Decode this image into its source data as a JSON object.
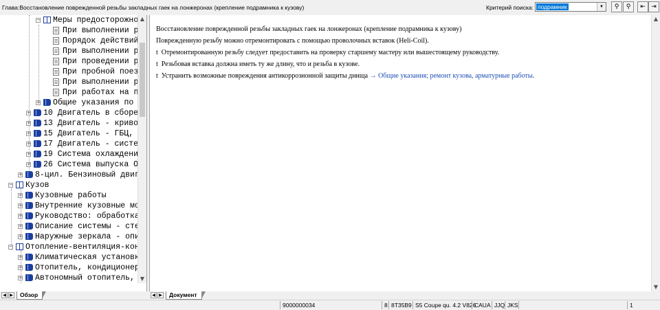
{
  "topbar": {
    "chapter_title": "Глава:Восстановление поврежденной резьбы закладных гаек на лонжеронах (крепление подрамника к кузову)",
    "search_label": "Критерий  поиска:",
    "search_value": "подрамник",
    "buttons": [
      "search-binoculars",
      "search-binoculars-next",
      "navigate-back",
      "navigate-forward"
    ]
  },
  "tree": {
    "items": [
      {
        "label": "Меры предосторожно",
        "icon": "open-book-icon",
        "expander": "minus"
      },
      {
        "label": "При выполнении р",
        "icon": "document-icon",
        "expander": ""
      },
      {
        "label": "Порядок действий",
        "icon": "document-icon",
        "expander": ""
      },
      {
        "label": "При выполнении р",
        "icon": "document-icon",
        "expander": ""
      },
      {
        "label": "При проведении р",
        "icon": "document-icon",
        "expander": ""
      },
      {
        "label": "При пробной поезд",
        "icon": "document-icon",
        "expander": ""
      },
      {
        "label": "При выполнении р",
        "icon": "document-icon",
        "expander": ""
      },
      {
        "label": "При работах на п",
        "icon": "document-icon",
        "expander": ""
      },
      {
        "label": "Общие указания по",
        "icon": "book-icon",
        "expander": "plus"
      },
      {
        "label": "10 Двигатель в сборе",
        "icon": "book-icon",
        "expander": "plus"
      },
      {
        "label": "13 Двигатель - криво",
        "icon": "book-icon",
        "expander": "plus"
      },
      {
        "label": "15 Двигатель - ГБЦ,",
        "icon": "book-icon",
        "expander": "plus"
      },
      {
        "label": "17 Двигатель - систе",
        "icon": "book-icon",
        "expander": "plus"
      },
      {
        "label": "19 Система охлаждени",
        "icon": "book-icon",
        "expander": "plus"
      },
      {
        "label": "26 Система выпуска О",
        "icon": "book-icon",
        "expander": "plus"
      },
      {
        "label": "8-цил. Бензиновый двиг",
        "icon": "book-icon",
        "expander": "plus"
      },
      {
        "label": "Кузов",
        "icon": "open-book-icon",
        "expander": "minus"
      },
      {
        "label": "Кузовные работы",
        "icon": "book-icon",
        "expander": "plus"
      },
      {
        "label": "Внутренние кузовные мо",
        "icon": "book-icon",
        "expander": "plus"
      },
      {
        "label": "Руководство: обработка",
        "icon": "book-icon",
        "expander": "plus"
      },
      {
        "label": "Описание системы - сте",
        "icon": "book-icon",
        "expander": "plus"
      },
      {
        "label": "Наружные зеркала - опи",
        "icon": "book-icon",
        "expander": "plus"
      },
      {
        "label": "Отопление-вентиляция-кон",
        "icon": "open-book-icon",
        "expander": "minus"
      },
      {
        "label": "Климатическая установк",
        "icon": "book-icon",
        "expander": "plus"
      },
      {
        "label": "Отопитель, кондиционер",
        "icon": "book-icon",
        "expander": "plus"
      },
      {
        "label": "Автономный отопитель,",
        "icon": "book-icon",
        "expander": "plus"
      }
    ]
  },
  "document": {
    "title": "Восстановление поврежденной резьбы закладных гаек на лонжеронах (крепление подрамника к кузову)",
    "intro": "Поврежденную резьбу можно отремонтировать с помощью проволочных вставок (Heli-Coil).",
    "bullet_glyph": "t",
    "bullets": [
      "Отремонтированную резьбу следует предоставить на проверку старшему мастеру или вышестоящему руководству.",
      "Резьбовая вставка должна иметь ту же длину, что и резьба в кузове."
    ],
    "last_bullet": "Устранить возможные повреждения антикоррозионной защиты днища",
    "last_link": "→ Общие указания; ремонт кузова, арматурные работы",
    "last_tail": "."
  },
  "tabs": {
    "left": "Обзор",
    "right": "Документ"
  },
  "status": {
    "doc_id": "9000000034",
    "cells": [
      "8",
      "8T35B9",
      "S5 Coupe qu. 4.2 V826",
      "CAUA",
      "JJQ",
      "JKS",
      "",
      "1"
    ]
  }
}
